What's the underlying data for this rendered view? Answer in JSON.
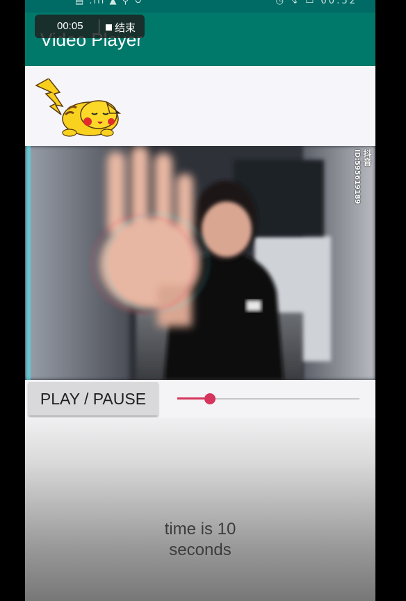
{
  "status_bar": {
    "left_icons": "▤ .ıll ▲ ⚲ ↻",
    "right_text": "◷ ↯ ▭ 00:52"
  },
  "app_bar": {
    "title": "Video Player"
  },
  "recording": {
    "elapsed": "00:05",
    "stop_label": "结束"
  },
  "video": {
    "watermark_app": "抖音",
    "watermark_id": "ID:595619189"
  },
  "controls": {
    "play_pause_label": "PLAY / PAUSE",
    "seek_progress": 0.18,
    "accent_color": "#d5345b"
  },
  "time_text": {
    "line1": "time is 10",
    "line2": "seconds"
  }
}
